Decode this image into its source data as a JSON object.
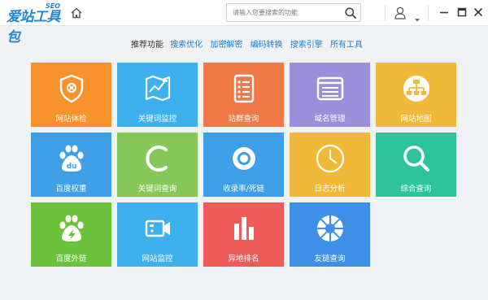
{
  "app": {
    "logo_text": "爱站工具包",
    "logo_sub": "SEO"
  },
  "search": {
    "placeholder": "请输入您要搜索的功能"
  },
  "recommend": {
    "label": "推荐功能",
    "links": [
      "搜索优化",
      "加密解密",
      "编码转换",
      "搜索引擎",
      "所有工具"
    ]
  },
  "tiles": [
    {
      "label": "网站体检",
      "color": "#f7922d",
      "icon": "shield-stethoscope-icon"
    },
    {
      "label": "关键词监控",
      "color": "#3fb0ee",
      "icon": "map-chart-icon"
    },
    {
      "label": "站群查询",
      "color": "#ef7a48",
      "icon": "list-icon"
    },
    {
      "label": "域名管理",
      "color": "#9b8fdc",
      "icon": "window-list-icon"
    },
    {
      "label": "网站地图",
      "color": "#f0b93a",
      "icon": "sitemap-icon"
    },
    {
      "label": "百度权重",
      "color": "#3f9fe6",
      "icon": "baidu-paw-icon"
    },
    {
      "label": "关键词查询",
      "color": "#86c95a",
      "icon": "c-letter-icon"
    },
    {
      "label": "收录率/死链",
      "color": "#3f9fe6",
      "icon": "target-ring-icon"
    },
    {
      "label": "日志分析",
      "color": "#f0b93a",
      "icon": "clock-icon"
    },
    {
      "label": "综合查询",
      "color": "#2dc49c",
      "icon": "magnifier-icon"
    },
    {
      "label": "百度外链",
      "color": "#6cc23d",
      "icon": "baidu-paw-bolt-icon"
    },
    {
      "label": "网站监控",
      "color": "#3fb0ee",
      "icon": "video-camera-icon"
    },
    {
      "label": "异地排名",
      "color": "#ef5b5b",
      "icon": "bar-chart-icon"
    },
    {
      "label": "友链查询",
      "color": "#3f8fe6",
      "icon": "aperture-icon"
    }
  ]
}
